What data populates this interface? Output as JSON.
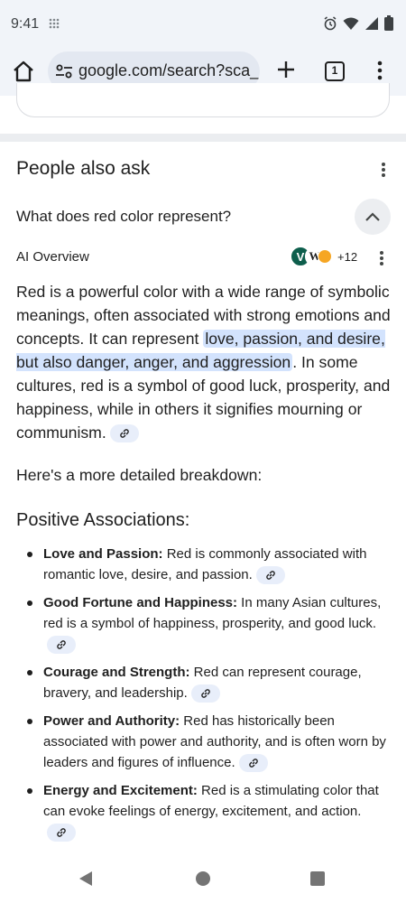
{
  "status_bar": {
    "time": "9:41"
  },
  "browser": {
    "url": "google.com/search?sca_",
    "tab_count": "1"
  },
  "paa": {
    "title": "People also ask",
    "question": "What does red color represent?",
    "ai_overview_label": "AI Overview",
    "source_more": "+12",
    "source_icons": [
      "V",
      "W"
    ],
    "overview_before": "Red is a powerful color with a wide range of symbolic meanings, often associated with strong emotions and concepts. It can represent ",
    "overview_highlight": "love, passion, and desire, but also danger, anger, and aggression",
    "overview_after": ". In some cultures, red is a symbol of good luck, prosperity, and happiness, while in others it signifies mourning or communism.",
    "breakdown": "Here's a more detailed breakdown:",
    "section_title": "Positive Associations:",
    "items": [
      {
        "term": "Love and Passion:",
        "text": " Red is commonly associated with romantic love, desire, and passion."
      },
      {
        "term": "Good Fortune and Happiness:",
        "text": " In many Asian cultures, red is a symbol of happiness, prosperity, and good luck."
      },
      {
        "term": "Courage and Strength:",
        "text": " Red can represent courage, bravery, and leadership."
      },
      {
        "term": "Power and Authority:",
        "text": " Red has historically been associated with power and authority, and is often worn by leaders and figures of influence."
      },
      {
        "term": "Energy and Excitement:",
        "text": " Red is a stimulating color that can evoke feelings of energy, excitement, and action."
      }
    ]
  },
  "colors": {
    "highlight": "#d3e3fd",
    "chip": "#e8eefa",
    "toolbar": "#f1f4f9"
  }
}
